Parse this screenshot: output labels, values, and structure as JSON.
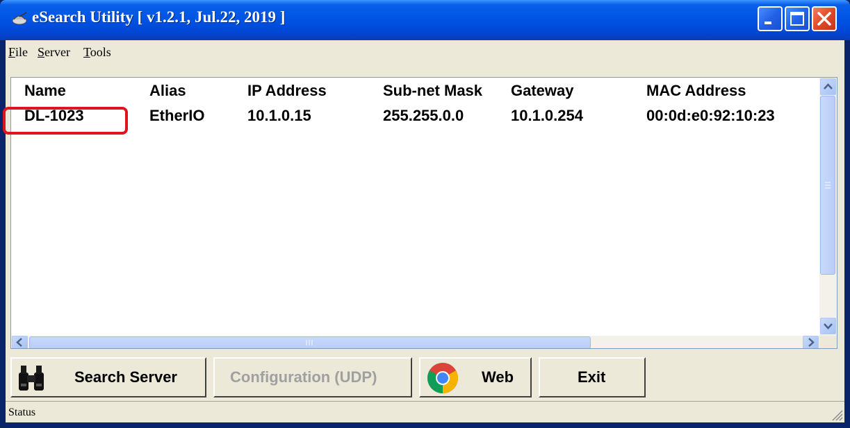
{
  "window": {
    "title": "eSearch Utility [ v1.2.1, Jul.22, 2019 ]"
  },
  "menu": [
    {
      "label": "File",
      "underline": "F",
      "rest": "ile"
    },
    {
      "label": "Server",
      "underline": "S",
      "rest": "erver"
    },
    {
      "label": "Tools",
      "underline": "T",
      "rest": "ools"
    }
  ],
  "table": {
    "columns": [
      "Name",
      "Alias",
      "IP Address",
      "Sub-net Mask",
      "Gateway",
      "MAC Address"
    ],
    "rows": [
      {
        "name": "DL-1023",
        "alias": "EtherIO",
        "ip": "10.1.0.15",
        "mask": "255.255.0.0",
        "gateway": "10.1.0.254",
        "mac": "00:0d:e0:92:10:23"
      }
    ],
    "selected_row": "DL-1023"
  },
  "toolbar": {
    "search_label": "Search Server",
    "config_label": "Configuration (UDP)",
    "config_enabled": false,
    "web_label": "Web",
    "exit_label": "Exit"
  },
  "status": {
    "text": "Status"
  },
  "colors": {
    "titlebar": "#0055e5",
    "window_bg": "#ece9d8",
    "highlight": "#e0141e",
    "disabled_text": "#a0a0a0"
  }
}
